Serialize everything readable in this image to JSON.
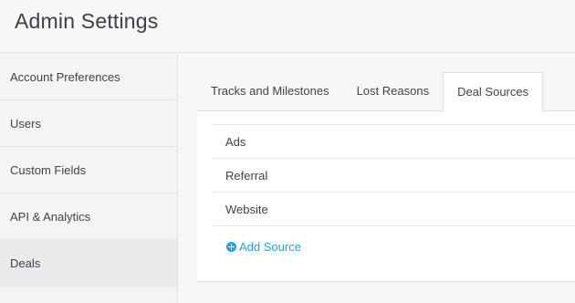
{
  "header": {
    "title": "Admin Settings"
  },
  "sidebar": {
    "items": [
      {
        "label": "Account Preferences"
      },
      {
        "label": "Users"
      },
      {
        "label": "Custom Fields"
      },
      {
        "label": "API & Analytics"
      },
      {
        "label": "Deals"
      }
    ],
    "active": "Deals"
  },
  "tabs": [
    {
      "label": "Tracks and Milestones"
    },
    {
      "label": "Lost Reasons"
    },
    {
      "label": "Deal Sources"
    }
  ],
  "active_tab": "Deal Sources",
  "sources": [
    {
      "label": "Ads"
    },
    {
      "label": "Referral"
    },
    {
      "label": "Website"
    }
  ],
  "add_source": {
    "label": "Add Source",
    "icon": "plus-circle-icon"
  },
  "colors": {
    "accent": "#2a9fd6",
    "active_sidebar_bg": "#e9eaeb",
    "page_bg": "#f7f7f7"
  }
}
